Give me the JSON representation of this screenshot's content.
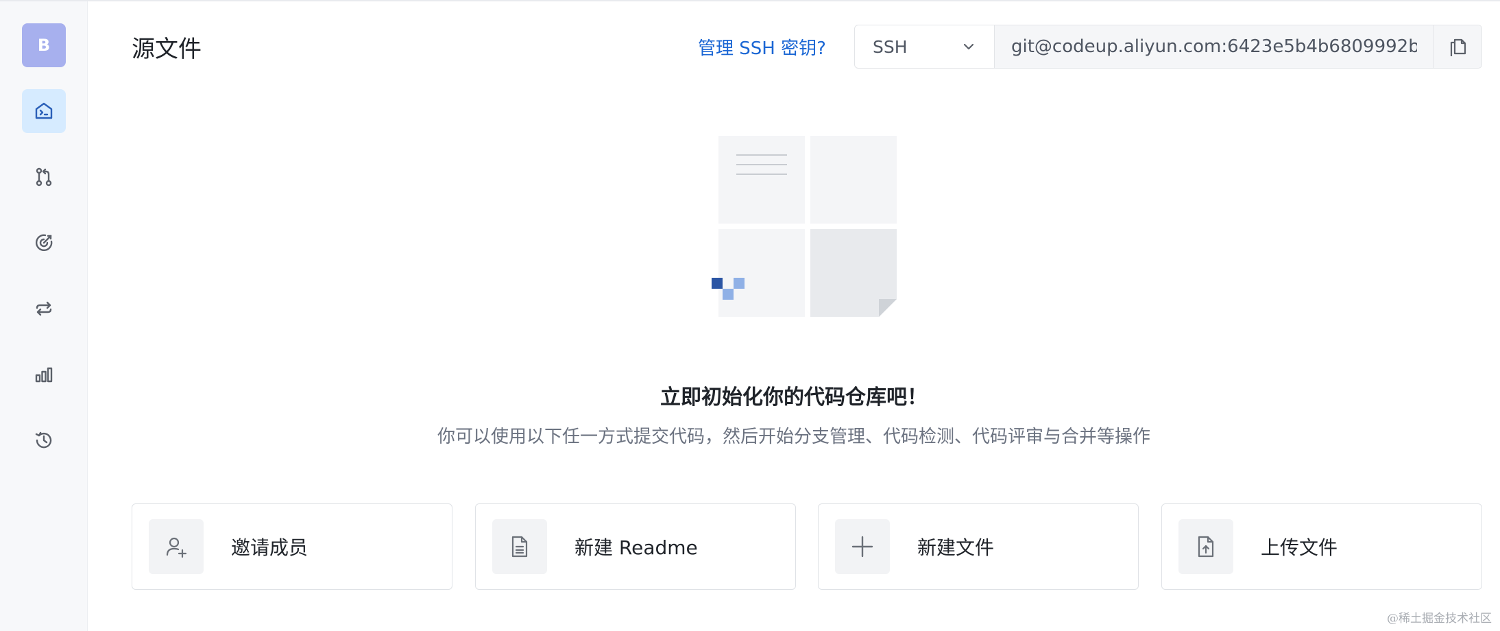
{
  "sidebar": {
    "avatar_letter": "B",
    "items": [
      {
        "icon": "repo-home-icon",
        "active": true
      },
      {
        "icon": "merge-request-icon",
        "active": false
      },
      {
        "icon": "target-icon",
        "active": false
      },
      {
        "icon": "sync-arrows-icon",
        "active": false
      },
      {
        "icon": "bar-chart-icon",
        "active": false
      },
      {
        "icon": "history-icon",
        "active": false
      }
    ]
  },
  "header": {
    "title": "源文件",
    "ssh_link": "管理 SSH 密钥?",
    "protocol": "SSH",
    "clone_url": "git@codeup.aliyun.com:6423e5b4b6809992b"
  },
  "empty_state": {
    "title": "立即初始化你的代码仓库吧！",
    "description": "你可以使用以下任一方式提交代码，然后开始分支管理、代码检测、代码评审与合并等操作"
  },
  "actions": [
    {
      "label": "邀请成员",
      "icon": "add-user-icon"
    },
    {
      "label": "新建 Readme",
      "icon": "document-icon"
    },
    {
      "label": "新建文件",
      "icon": "plus-icon"
    },
    {
      "label": "上传文件",
      "icon": "file-upload-icon"
    }
  ],
  "watermark": "@稀土掘金技术社区",
  "colors": {
    "accent": "#1a66d4",
    "active_nav_bg": "#d6ebff",
    "avatar_bg": "#a7b0ee"
  }
}
